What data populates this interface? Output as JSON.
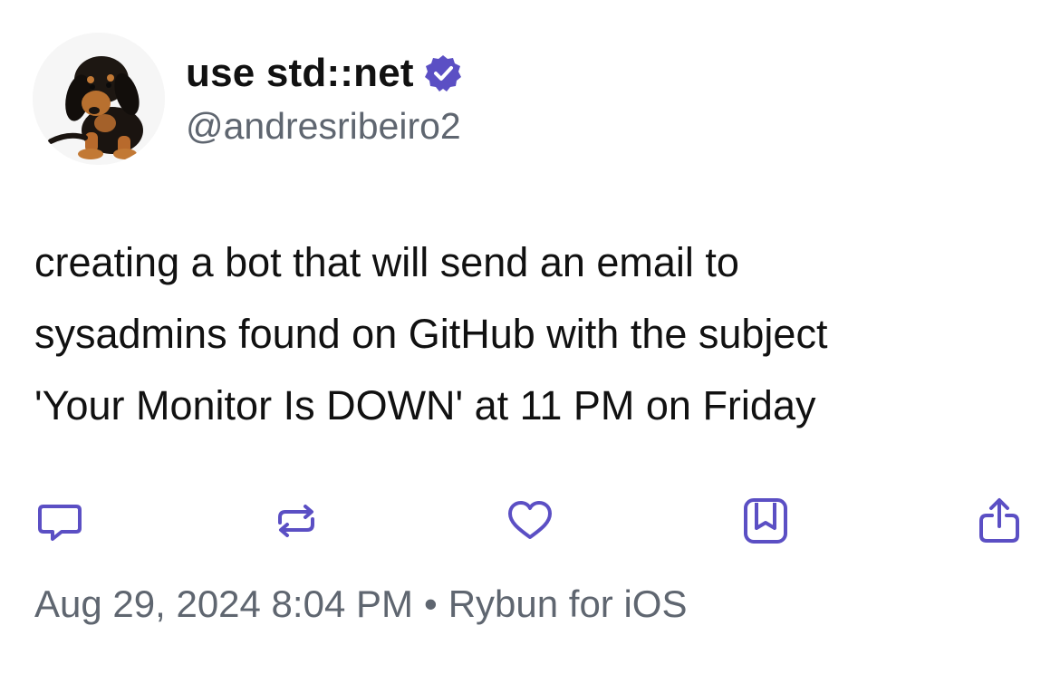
{
  "author": {
    "display_name": "use std::net",
    "handle": "@andresribeiro2",
    "verified": true,
    "avatar_icon": "dachshund-puppy-avatar"
  },
  "tweet": {
    "lines": [
      "creating a bot that will send an email to",
      "sysadmins found on GitHub with the subject",
      "'Your Monitor Is DOWN' at 11 PM on Friday"
    ]
  },
  "actions": [
    {
      "name": "reply",
      "icon": "reply-bubble-icon"
    },
    {
      "name": "repost",
      "icon": "repost-icon"
    },
    {
      "name": "like",
      "icon": "heart-icon"
    },
    {
      "name": "bookmark",
      "icon": "bookmark-icon"
    },
    {
      "name": "share",
      "icon": "share-icon"
    }
  ],
  "meta": {
    "timestamp": "Aug 29, 2024 8:04 PM",
    "separator": "•",
    "client": "Rybun for iOS"
  },
  "colors": {
    "accent": "#5b4fc4",
    "text": "#111111",
    "secondary_text": "#5f6670",
    "background": "#ffffff"
  }
}
